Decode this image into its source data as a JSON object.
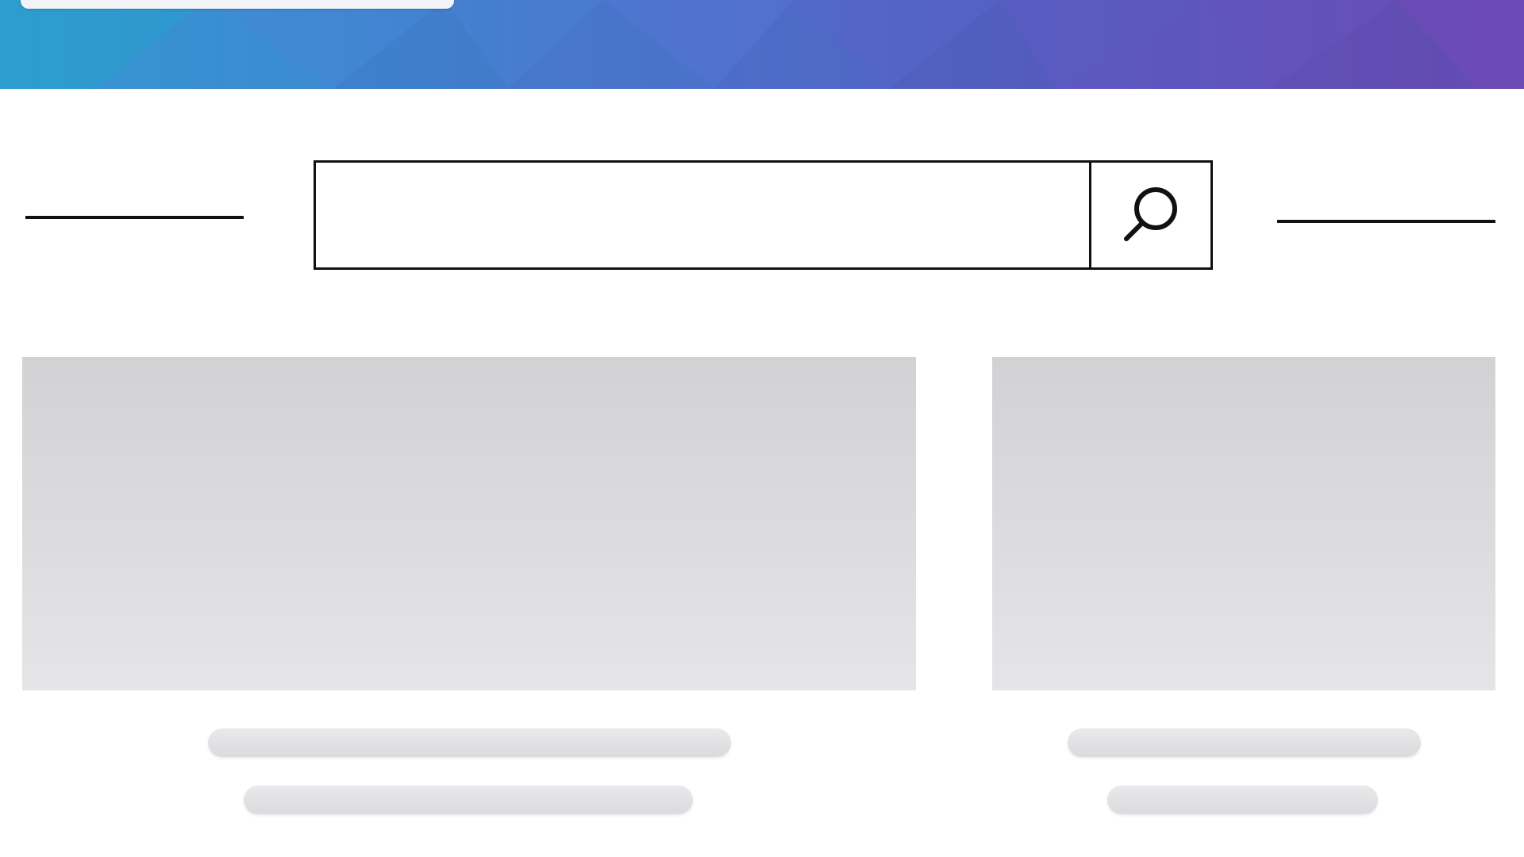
{
  "header": {
    "banner_style": "polygon-gradient",
    "colors": {
      "gradient_start": "#2f9fd0",
      "gradient_mid": "#4f6fcb",
      "gradient_end": "#6a49b4"
    }
  },
  "search": {
    "value": "",
    "placeholder": "",
    "button_icon": "search-icon"
  },
  "content": {
    "cards": [
      {
        "type": "image-placeholder",
        "title_lines": 2
      },
      {
        "type": "image-placeholder",
        "title_lines": 2
      }
    ],
    "placeholder_color": "#d9d9db"
  }
}
